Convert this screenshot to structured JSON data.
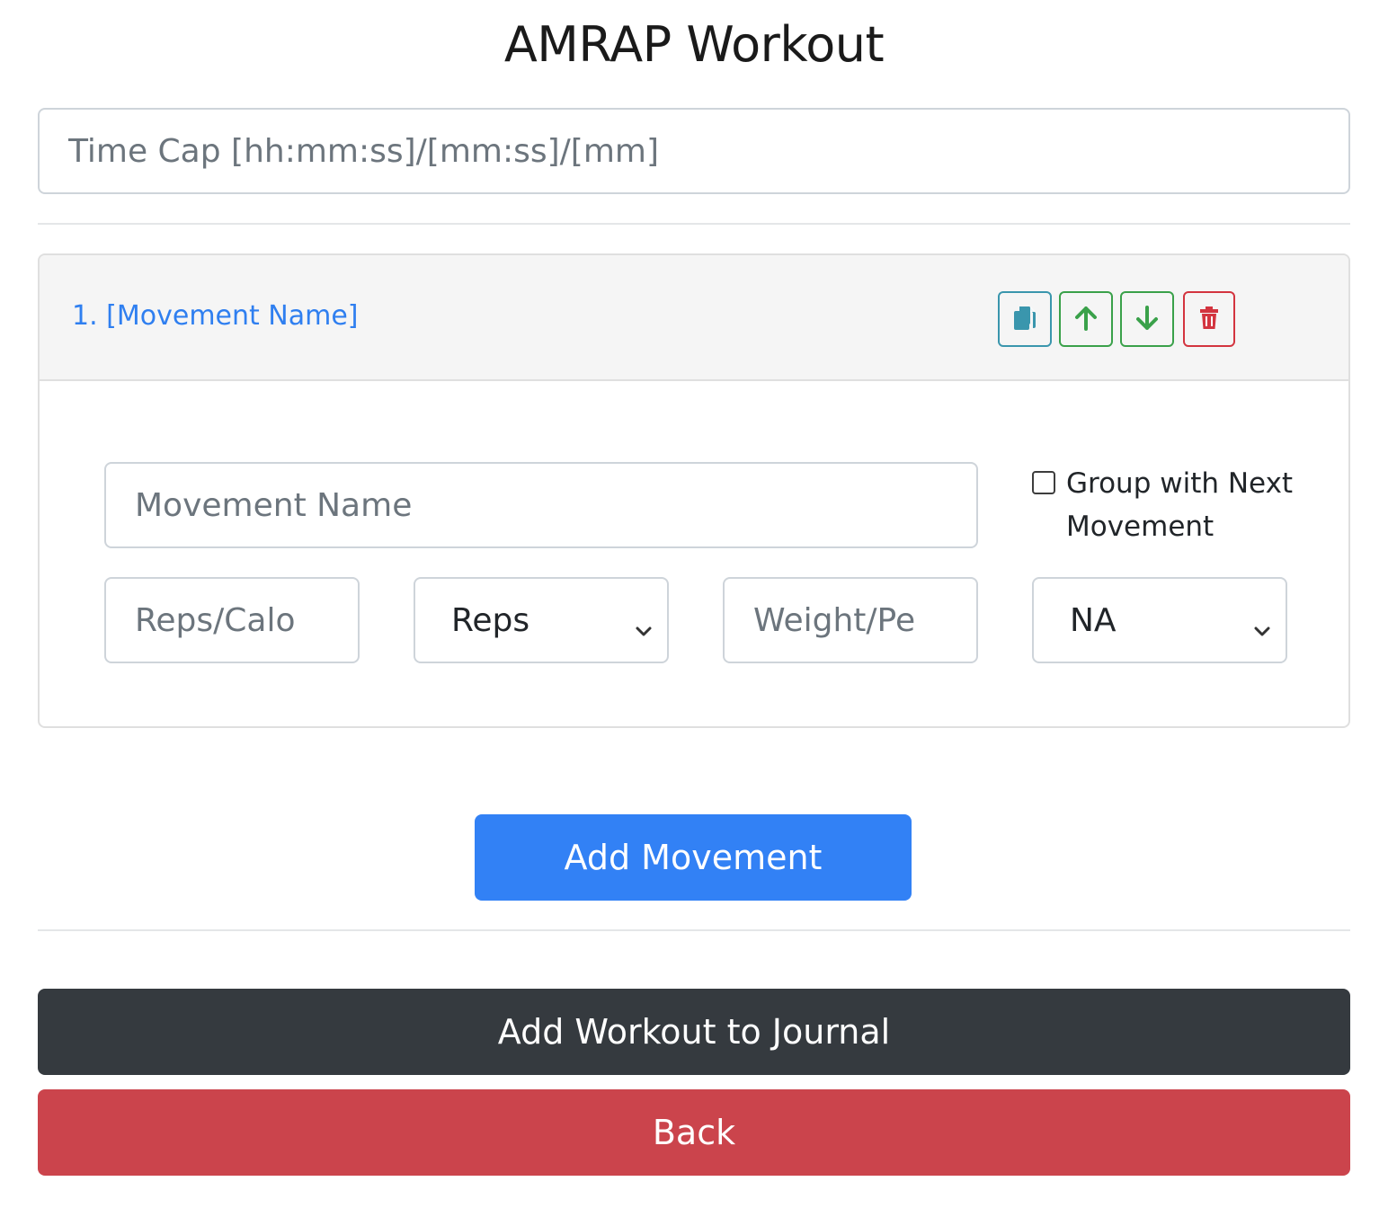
{
  "page": {
    "title": "AMRAP Workout"
  },
  "time_cap": {
    "placeholder": "Time Cap [hh:mm:ss]/[mm:ss]/[mm]",
    "value": ""
  },
  "movement_card": {
    "header_label": "1. [Movement Name]",
    "actions": [
      {
        "name": "copy",
        "icon": "copy-icon",
        "color": "#3a96ad"
      },
      {
        "name": "move-up",
        "icon": "arrow-up-icon",
        "color": "#3aa14a"
      },
      {
        "name": "move-down",
        "icon": "arrow-down-icon",
        "color": "#3aa14a"
      },
      {
        "name": "delete",
        "icon": "trash-icon",
        "color": "#d3343f"
      }
    ],
    "movement_name": {
      "placeholder": "Movement Name",
      "value": ""
    },
    "group_with_next": {
      "label": "Group with Next Movement",
      "checked": false
    },
    "reps": {
      "placeholder": "Reps/Calo",
      "value": ""
    },
    "unit_select": {
      "selected": "Reps"
    },
    "weight": {
      "placeholder": "Weight/Pe",
      "value": ""
    },
    "weight_unit_select": {
      "selected": "NA"
    }
  },
  "buttons": {
    "add_movement": "Add Movement",
    "add_to_journal": "Add Workout to Journal",
    "back": "Back"
  },
  "colors": {
    "primary": "#3281f5",
    "dark": "#353a3f",
    "danger": "#cb444c",
    "link": "#2f7ff0",
    "info": "#3a96ad",
    "success": "#3aa14a"
  }
}
